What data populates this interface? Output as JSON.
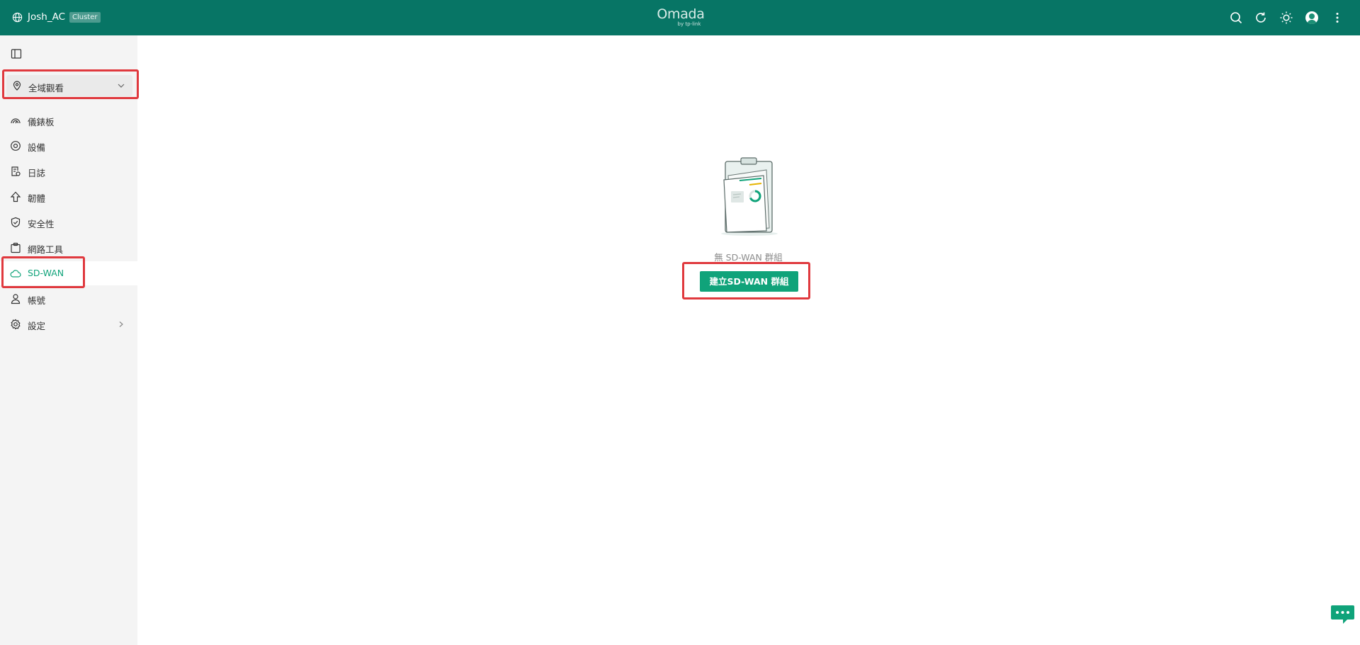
{
  "topbar": {
    "controller_name": "Josh_AC",
    "controller_badge": "Cluster",
    "brand": "Omada",
    "brand_sub": "by tp-link",
    "icons": [
      "globe-icon",
      "search-icon",
      "refresh-icon",
      "theme-sun-icon",
      "avatar",
      "more-vertical-icon"
    ],
    "background_color": "#077565"
  },
  "sidebar": {
    "site_selector": {
      "label": "全域觀看",
      "icon": "location-pin-icon"
    },
    "items": [
      {
        "label": "儀錶板",
        "icon": "dashboard-icon"
      },
      {
        "label": "設備",
        "icon": "devices-icon"
      },
      {
        "label": "日誌",
        "icon": "logs-icon"
      },
      {
        "label": "韌體",
        "icon": "firmware-icon"
      },
      {
        "label": "安全性",
        "icon": "security-shield-icon"
      },
      {
        "label": "網路工具",
        "icon": "network-tools-icon"
      },
      {
        "label": "SD-WAN",
        "icon": "cloud-icon",
        "active": true
      },
      {
        "label": "帳號",
        "icon": "account-icon"
      },
      {
        "label": "設定",
        "icon": "settings-gear-icon",
        "has_submenu": true
      }
    ]
  },
  "main": {
    "empty_state_text": "無 SD-WAN 群組",
    "create_button": "建立SD-WAN 群組",
    "accent_color": "#10a37a"
  },
  "annotations": {
    "highlight_color": "#e0393e",
    "highlighted": [
      "site-selector",
      "nav-item-sd-wan",
      "create-sdwan-group-button"
    ]
  }
}
